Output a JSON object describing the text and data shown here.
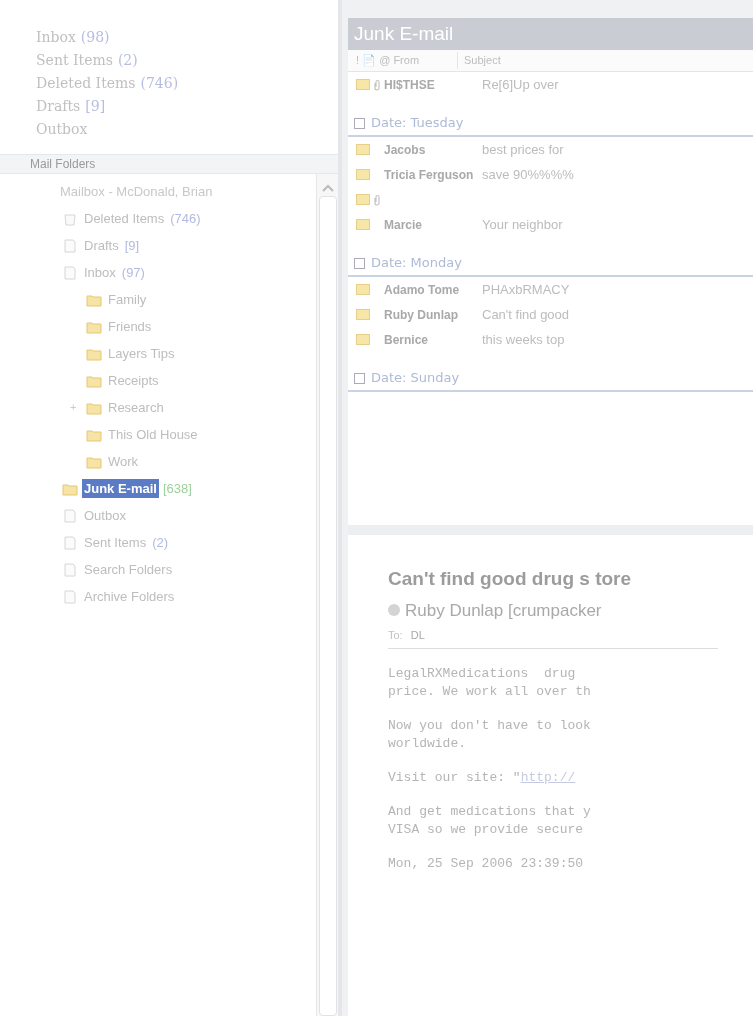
{
  "favorites": [
    {
      "label": "Inbox",
      "count": "(98)"
    },
    {
      "label": "Sent Items",
      "count": "(2)"
    },
    {
      "label": "Deleted Items",
      "count": "(746)"
    },
    {
      "label": "Drafts",
      "count": "[9]"
    },
    {
      "label": "Outbox"
    }
  ],
  "folders_header": "Mail Folders",
  "folder_tree": {
    "label": "Mailbox - McDonald, Brian",
    "children": [
      {
        "label": "Deleted Items",
        "count": "(746)",
        "kind": "trash",
        "selected": false
      },
      {
        "label": "Drafts",
        "count": "[9]",
        "kind": "page",
        "selected": false
      },
      {
        "label": "Inbox",
        "count": "(97)",
        "kind": "page",
        "selected": false,
        "children": [
          {
            "label": "Family",
            "kind": "folder",
            "selected": false
          },
          {
            "label": "Friends",
            "kind": "folder",
            "selected": false
          },
          {
            "label": "Layers Tips",
            "kind": "folder",
            "selected": false
          },
          {
            "label": "Receipts",
            "kind": "folder",
            "selected": false
          },
          {
            "label": "Research",
            "kind": "folder",
            "selected": false,
            "expander": "+"
          },
          {
            "label": "This Old House",
            "kind": "folder",
            "selected": false
          },
          {
            "label": "Work",
            "kind": "folder",
            "selected": false
          }
        ]
      },
      {
        "label": "Junk E-mail",
        "count": "[638]",
        "kind": "folder",
        "selected": true
      },
      {
        "label": "Outbox",
        "kind": "page",
        "selected": false
      },
      {
        "label": "Sent Items",
        "count": "(2)",
        "kind": "page",
        "selected": false
      },
      {
        "label": "Search Folders",
        "kind": "page",
        "selected": false
      },
      {
        "label": "Archive Folders",
        "kind": "page",
        "selected": false
      }
    ]
  },
  "list_title": "Junk E-mail",
  "columns": [
    {
      "label": "! 📄 @ From"
    },
    {
      "label": "Subject"
    }
  ],
  "groups": [
    {
      "rows": [
        {
          "from": "HI$THSE",
          "subject": "Re[6]Up over",
          "attachment": true
        }
      ]
    },
    {
      "header": "Date: Tuesday",
      "rows": [
        {
          "from": "Jacobs",
          "subject": "best prices for",
          "attachment": false
        },
        {
          "from": "Tricia Ferguson",
          "subject": "save 90%%%%",
          "attachment": false
        },
        {
          "from": "",
          "subject": "",
          "attachment": true
        },
        {
          "from": "Marcie",
          "subject": "Your neighbor",
          "attachment": false
        }
      ]
    },
    {
      "header": "Date: Monday",
      "rows": [
        {
          "from": "Adamo Tome",
          "subject": "PHAxbRMACY",
          "attachment": false
        },
        {
          "from": "Ruby Dunlap",
          "subject": "Can't find good",
          "attachment": false
        },
        {
          "from": "Bernice",
          "subject": "this weeks top",
          "attachment": false
        }
      ]
    },
    {
      "header": "Date: Sunday"
    }
  ],
  "message": {
    "subject": "Can't find good drug s tore",
    "sender": "Ruby Dunlap [crumpacker",
    "to_label": "To:",
    "to": "DL",
    "paragraphs": [
      {
        "lines": [
          "LegalRXMedications  drug",
          "price. We work all over th"
        ]
      },
      {
        "lines": [
          "Now you don't have to look",
          "worldwide."
        ]
      },
      {
        "lines": [
          "Visit our site: \""
        ],
        "link": "http://"
      },
      {
        "lines": [
          "And get medications that y",
          "VISA so we provide secure"
        ]
      },
      {
        "lines": [
          "Mon, 25 Sep 2006 23:39:50"
        ]
      }
    ]
  }
}
